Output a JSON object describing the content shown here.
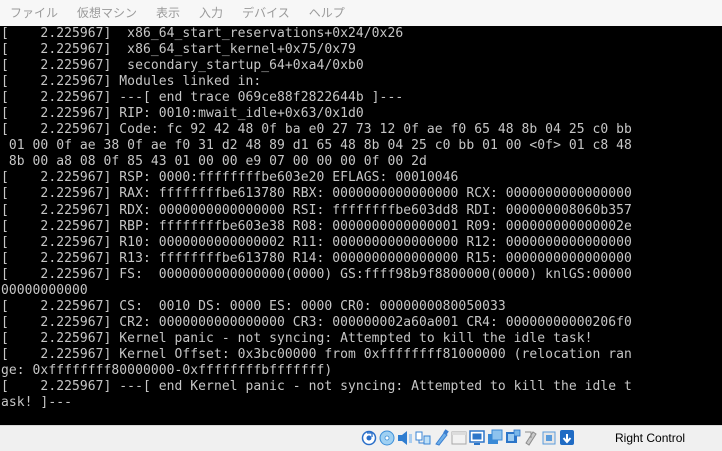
{
  "menubar": {
    "items": [
      "ファイル",
      "仮想マシン",
      "表示",
      "入力",
      "デバイス",
      "ヘルプ"
    ]
  },
  "console": {
    "lines": [
      "[    2.225967]  x86_64_start_reservations+0x24/0x26",
      "[    2.225967]  x86_64_start_kernel+0x75/0x79",
      "[    2.225967]  secondary_startup_64+0xa4/0xb0",
      "[    2.225967] Modules linked in:",
      "[    2.225967] ---[ end trace 069ce88f2822644b ]---",
      "[    2.225967] RIP: 0010:mwait_idle+0x63/0x1d0",
      "[    2.225967] Code: fc 92 42 48 0f ba e0 27 73 12 0f ae f0 65 48 8b 04 25 c0 bb",
      " 01 00 0f ae 38 0f ae f0 31 d2 48 89 d1 65 48 8b 04 25 c0 bb 01 00 <0f> 01 c8 48",
      " 8b 00 a8 08 0f 85 43 01 00 00 e9 07 00 00 00 0f 00 2d",
      "[    2.225967] RSP: 0000:ffffffffbe603e20 EFLAGS: 00010046",
      "[    2.225967] RAX: ffffffffbe613780 RBX: 0000000000000000 RCX: 0000000000000000",
      "[    2.225967] RDX: 0000000000000000 RSI: ffffffffbe603dd8 RDI: 000000008060b357",
      "[    2.225967] RBP: ffffffffbe603e38 R08: 0000000000000001 R09: 000000000000002e",
      "[    2.225967] R10: 0000000000000002 R11: 0000000000000000 R12: 0000000000000000",
      "[    2.225967] R13: ffffffffbe613780 R14: 0000000000000000 R15: 0000000000000000",
      "[    2.225967] FS:  0000000000000000(0000) GS:ffff98b9f8800000(0000) knlGS:00000",
      "00000000000",
      "[    2.225967] CS:  0010 DS: 0000 ES: 0000 CR0: 0000000080050033",
      "[    2.225967] CR2: 0000000000000000 CR3: 000000002a60a001 CR4: 00000000000206f0",
      "[    2.225967] Kernel panic - not syncing: Attempted to kill the idle task!",
      "[    2.225967] Kernel Offset: 0x3bc00000 from 0xffffffff81000000 (relocation ran",
      "ge: 0xffffffff80000000-0xffffffffbfffffff)",
      "[    2.225967] ---[ end Kernel panic - not syncing: Attempted to kill the idle t",
      "ask! ]---"
    ]
  },
  "statusbar": {
    "host_key": "Right Control",
    "icons": [
      {
        "name": "hard-disk-icon",
        "color": "#2a6fc9"
      },
      {
        "name": "optical-drive-icon",
        "color": "#3d8fd8"
      },
      {
        "name": "audio-icon",
        "color": "#2f7dd0"
      },
      {
        "name": "network-icon",
        "color": "#3a84d4"
      },
      {
        "name": "usb-icon",
        "color": "#3b7fd0"
      },
      {
        "name": "shared-folders-icon",
        "color": "#e8e8e8"
      },
      {
        "name": "display-icon",
        "color": "#2d76c9"
      },
      {
        "name": "video-capture-icon",
        "color": "#3a8ad6"
      },
      {
        "name": "recording-icon",
        "color": "#2c75c8"
      },
      {
        "name": "mouse-integration-icon",
        "color": "#8c8c8c"
      },
      {
        "name": "cpu-icon",
        "color": "#5a9cdc"
      },
      {
        "name": "host-key-icon",
        "color": "#1f6bc4"
      }
    ]
  }
}
